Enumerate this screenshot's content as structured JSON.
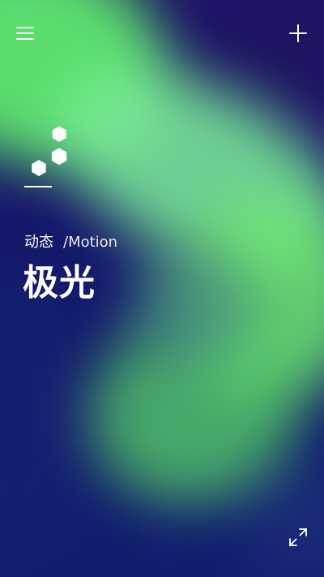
{
  "header": {
    "menu_icon": "hamburger-menu-icon",
    "add_icon": "plus-icon"
  },
  "logo": {
    "icon": "hexagon-cluster-logo-icon",
    "color": "#ffffff"
  },
  "content": {
    "category": "动态",
    "subtitle": "/Motion",
    "title": "极光"
  },
  "footer": {
    "expand_icon": "expand-fullscreen-icon"
  },
  "colors": {
    "text": "#ffffff",
    "aurora_green": "#6ee870",
    "night_sky": "#15186a"
  }
}
